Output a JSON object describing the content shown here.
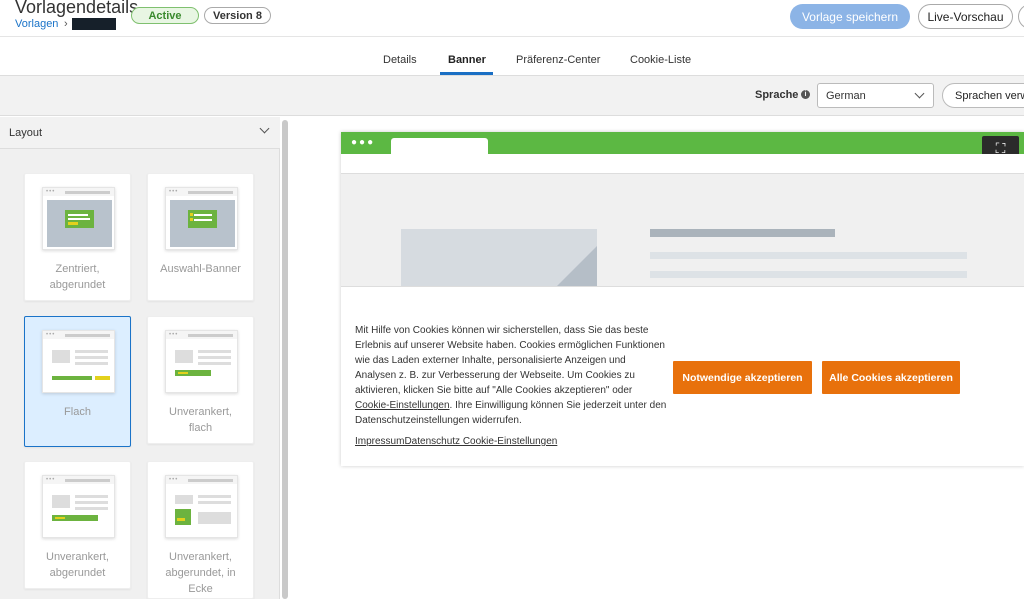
{
  "header": {
    "title": "Vorlagendetails",
    "breadcrumb_root": "Vorlagen",
    "breadcrumb_sep": "›",
    "status_badge": "Active",
    "version_badge": "Version 8",
    "save_button": "Vorlage speichern",
    "preview_button": "Live-Vorschau"
  },
  "tabs": [
    {
      "label": "Details"
    },
    {
      "label": "Banner",
      "active": true
    },
    {
      "label": "Präferenz-Center"
    },
    {
      "label": "Cookie-Liste"
    }
  ],
  "toolbar": {
    "language_label": "Sprache",
    "language_value": "German",
    "manage_languages_button": "Sprachen verw"
  },
  "layout_panel": {
    "title": "Layout",
    "options": [
      {
        "label_lines": [
          "Zentriert,",
          "abgerundet"
        ],
        "selected": false
      },
      {
        "label_lines": [
          "Auswahl-Banner"
        ],
        "selected": false
      },
      {
        "label_lines": [
          "Flach"
        ],
        "selected": true
      },
      {
        "label_lines": [
          "Unverankert,",
          "flach"
        ],
        "selected": false
      },
      {
        "label_lines": [
          "Unverankert,",
          "abgerundet"
        ],
        "selected": false
      },
      {
        "label_lines": [
          "Unverankert,",
          "abgerundet, in",
          "Ecke"
        ],
        "selected": false
      }
    ]
  },
  "banner": {
    "text_part1": "Mit Hilfe von Cookies können wir sicherstellen, dass Sie das beste Erlebnis auf unserer Website haben. Cookies ermöglichen Funktionen wie das Laden externer Inhalte, personalisierte Anzeigen und Analysen z. B. zur Verbesserung der Webseite. Um Cookies zu aktivieren, klicken Sie bitte auf \"Alle Cookies akzeptieren\" oder ",
    "text_link": "Cookie-Einstellungen",
    "text_part2": ". Ihre Einwilligung können Sie jederzeit unter den Datenschutzeinstellungen widerrufen.",
    "footer_links": "ImpressumDatenschutz Cookie-Einstellungen",
    "button_necessary": "Notwendige akzeptieren",
    "button_all": "Alle Cookies akzeptieren"
  },
  "colors": {
    "accent_blue": "#1a73c8",
    "banner_green": "#5cb843",
    "button_orange": "#e8710c"
  },
  "icons": {
    "info": "info-icon",
    "chevron": "chevron-down-icon",
    "expand": "expand-icon"
  }
}
